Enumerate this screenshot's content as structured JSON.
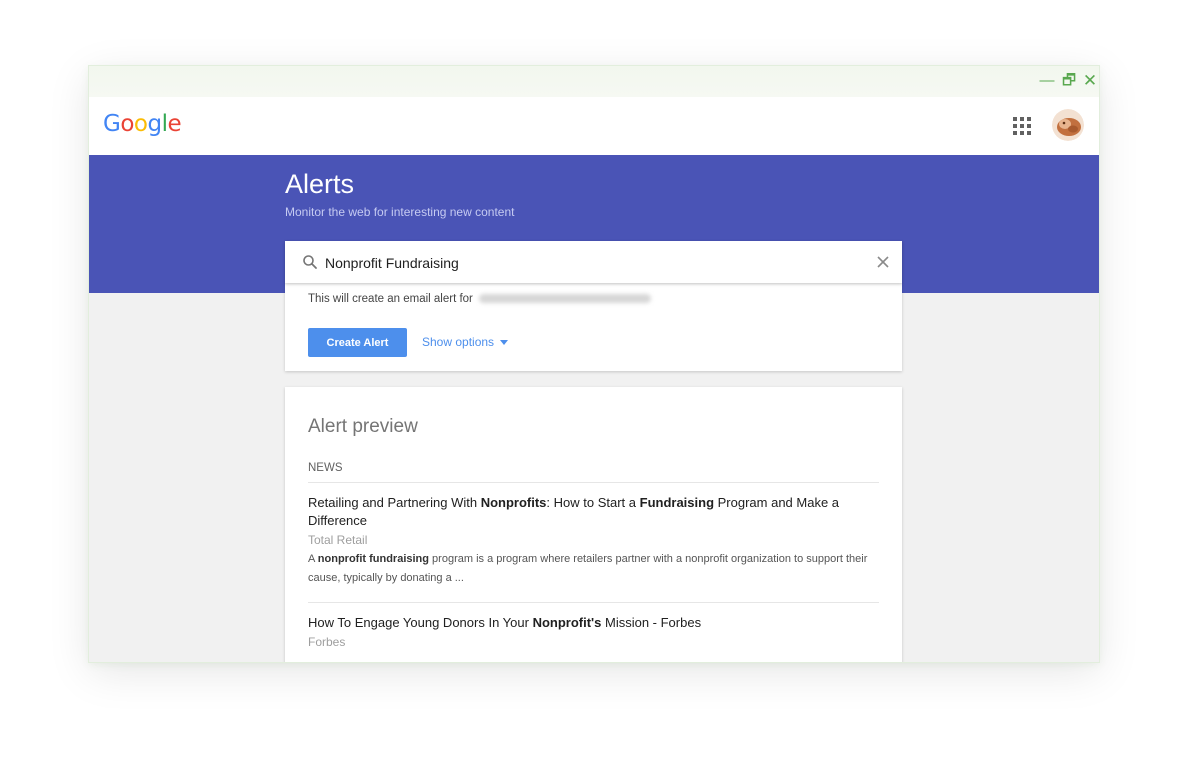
{
  "window_controls": {
    "minimize": "—",
    "maximize": "🗗",
    "close": "✕"
  },
  "header": {
    "logo_letters": [
      {
        "ch": "G",
        "color": "#4285F4"
      },
      {
        "ch": "o",
        "color": "#EA4335"
      },
      {
        "ch": "o",
        "color": "#FBBC05"
      },
      {
        "ch": "g",
        "color": "#4285F4"
      },
      {
        "ch": "l",
        "color": "#34A853"
      },
      {
        "ch": "e",
        "color": "#EA4335"
      }
    ]
  },
  "banner": {
    "title": "Alerts",
    "subtitle": "Monitor the web for interesting new content",
    "color": "#4A54B6"
  },
  "search": {
    "value": "Nonprofit Fundraising"
  },
  "options": {
    "email_text": "This will create an email alert for",
    "create_label": "Create Alert",
    "show_options_label": "Show options",
    "accent": "#4D8FEC"
  },
  "preview": {
    "title": "Alert preview",
    "section": "NEWS",
    "items": [
      {
        "title_parts": [
          {
            "text": "Retailing and Partnering With ",
            "bold": false
          },
          {
            "text": "Nonprofits",
            "bold": true
          },
          {
            "text": ": How to Start a ",
            "bold": false
          },
          {
            "text": "Fundraising",
            "bold": true
          },
          {
            "text": " Program and Make a Difference",
            "bold": false
          }
        ],
        "source": "Total Retail",
        "snippet_parts": [
          {
            "text": "A ",
            "bold": false
          },
          {
            "text": "nonprofit fundraising",
            "bold": true
          },
          {
            "text": " program is a program where retailers partner with a nonprofit organization to support their cause, typically by donating a ...",
            "bold": false
          }
        ]
      },
      {
        "title_parts": [
          {
            "text": "How To Engage Young Donors In Your ",
            "bold": false
          },
          {
            "text": "Nonprofit's",
            "bold": true
          },
          {
            "text": " Mission - Forbes",
            "bold": false
          }
        ],
        "source": "Forbes",
        "snippet_parts": []
      }
    ]
  }
}
